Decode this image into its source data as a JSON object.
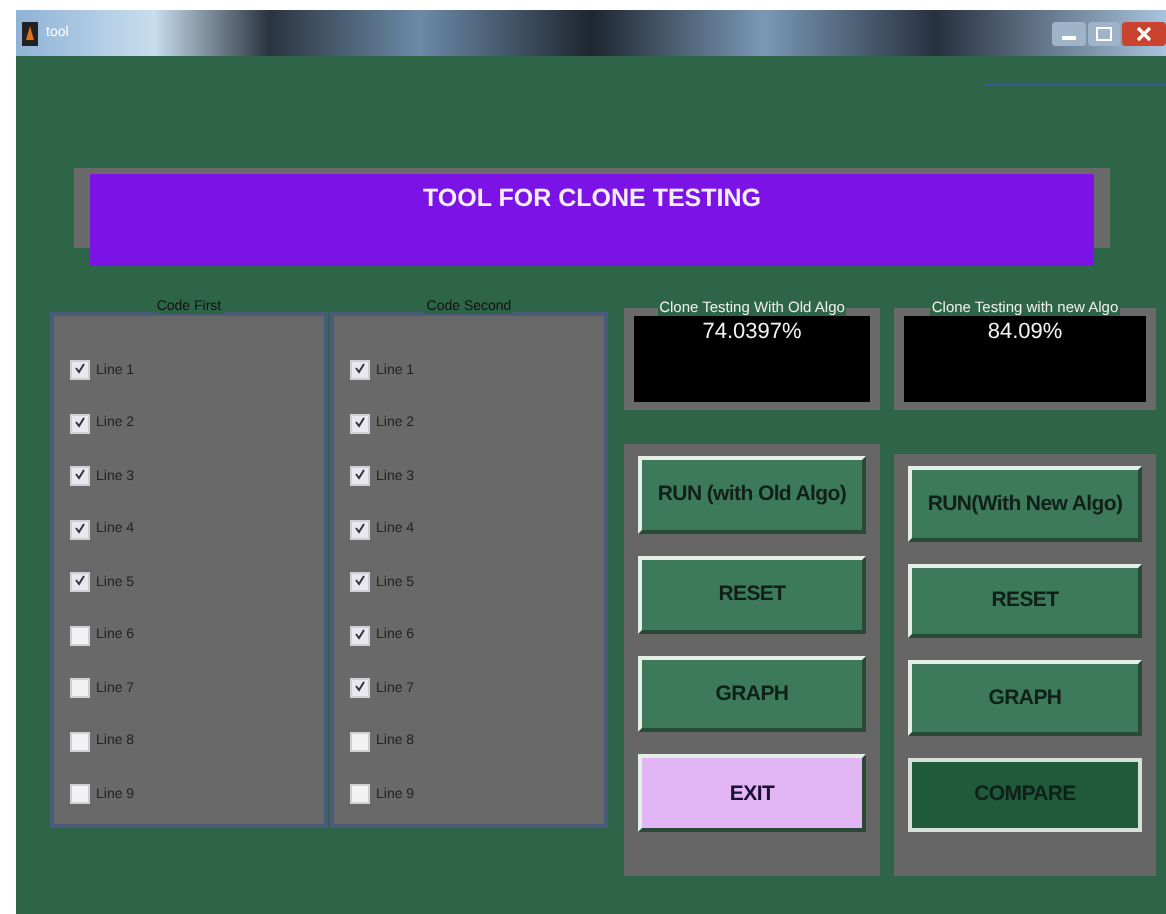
{
  "window": {
    "title": "tool"
  },
  "banner": {
    "title": "TOOL FOR CLONE TESTING"
  },
  "code_panels": [
    {
      "title": "Code First",
      "lines": [
        {
          "label": "Line 1",
          "checked": true
        },
        {
          "label": "Line 2",
          "checked": true
        },
        {
          "label": "Line 3",
          "checked": true
        },
        {
          "label": "Line 4",
          "checked": true
        },
        {
          "label": "Line 5",
          "checked": true
        },
        {
          "label": "Line 6",
          "checked": false
        },
        {
          "label": "Line 7",
          "checked": false
        },
        {
          "label": "Line 8",
          "checked": false
        },
        {
          "label": "Line 9",
          "checked": false
        }
      ]
    },
    {
      "title": "Code Second",
      "lines": [
        {
          "label": "Line 1",
          "checked": true
        },
        {
          "label": "Line 2",
          "checked": true
        },
        {
          "label": "Line 3",
          "checked": true
        },
        {
          "label": "Line 4",
          "checked": true
        },
        {
          "label": "Line 5",
          "checked": true
        },
        {
          "label": "Line 6",
          "checked": true
        },
        {
          "label": "Line 7",
          "checked": true
        },
        {
          "label": "Line 8",
          "checked": false
        },
        {
          "label": "Line 9",
          "checked": false
        }
      ]
    }
  ],
  "results": [
    {
      "title": "Clone Testing With Old Algo",
      "value": "74.0397%"
    },
    {
      "title": "Clone Testing with new Algo",
      "value": "84.09%"
    }
  ],
  "button_panels": [
    {
      "buttons": [
        {
          "label": "RUN (with Old Algo)",
          "kind": "normal"
        },
        {
          "label": "RESET",
          "kind": "normal"
        },
        {
          "label": "GRAPH",
          "kind": "normal"
        },
        {
          "label": "EXIT",
          "kind": "exit"
        }
      ]
    },
    {
      "buttons": [
        {
          "label": "RUN(With New Algo)",
          "kind": "normal"
        },
        {
          "label": "RESET",
          "kind": "normal"
        },
        {
          "label": "GRAPH",
          "kind": "normal"
        },
        {
          "label": "COMPARE",
          "kind": "compare"
        }
      ]
    }
  ]
}
